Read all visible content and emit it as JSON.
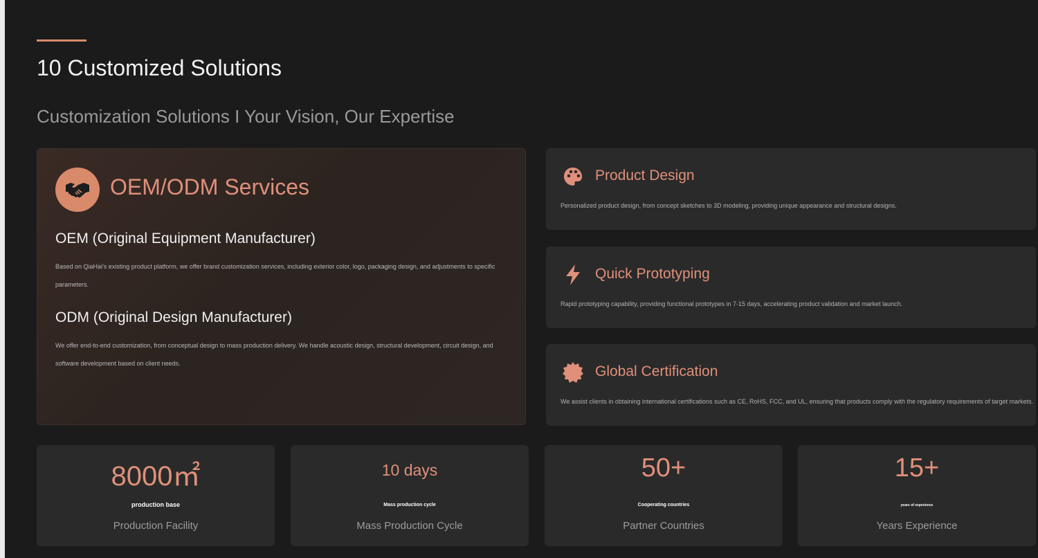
{
  "header": {
    "title": "10 Customized Solutions",
    "subtitle": "Customization Solutions I Your Vision, Our Expertise"
  },
  "oem_card": {
    "icon": "handshake-icon",
    "title": "OEM/ODM Services",
    "oem_heading": "OEM (Original Equipment Manufacturer)",
    "oem_text": "Based on QiaHai's existing product platform, we offer brand customization services, including exterior color, logo, packaging design, and adjustments to specific parameters.",
    "odm_heading": "ODM (Original Design Manufacturer)",
    "odm_text": "We offer end-to-end customization, from conceptual design to mass production delivery. We handle acoustic design, structural development, circuit design, and software development based on client needs."
  },
  "features": [
    {
      "icon": "palette-icon",
      "title": "Product Design",
      "description": "Personalized product design, from concept sketches to 3D modeling, providing unique appearance and structural designs."
    },
    {
      "icon": "lightning-icon",
      "title": "Quick Prototyping",
      "description": "Rapid prototyping capability, providing functional prototypes in 7-15 days, accelerating product validation and market launch."
    },
    {
      "icon": "certificate-badge-icon",
      "title": "Global Certification",
      "description": "We assist clients in obtaining international certifications such as CE, RoHS, FCC, and UL, ensuring that products comply with the regulatory requirements of target markets."
    }
  ],
  "stats": [
    {
      "value": "8000㎡",
      "small": "production base",
      "label": "Production Facility"
    },
    {
      "value": "10 days",
      "small": "Mass production cycle",
      "label": "Mass Production Cycle"
    },
    {
      "value": "50+",
      "small": "Cooperating countries",
      "label": "Partner Countries"
    },
    {
      "value": "15+",
      "small": "years of experience",
      "label": "Years Experience"
    }
  ],
  "colors": {
    "background": "#1b1b1b",
    "card": "#2a2a2a",
    "accent": "#d98a6a"
  }
}
